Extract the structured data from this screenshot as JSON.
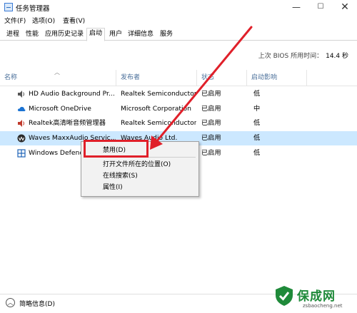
{
  "window": {
    "title": "任务管理器",
    "buttons": {
      "minimize": "—",
      "maximize": "☐",
      "close": "✕"
    }
  },
  "menu": [
    "文件(F)",
    "选项(O)",
    "查看(V)"
  ],
  "tabs": [
    {
      "label": "进程",
      "active": false
    },
    {
      "label": "性能",
      "active": false
    },
    {
      "label": "应用历史记录",
      "active": false
    },
    {
      "label": "启动",
      "active": true
    },
    {
      "label": "用户",
      "active": false
    },
    {
      "label": "详细信息",
      "active": false
    },
    {
      "label": "服务",
      "active": false
    }
  ],
  "bios": {
    "label": "上次 BIOS 所用时间：",
    "value": "14.4 秒"
  },
  "columns": {
    "name": "名称",
    "publisher": "发布者",
    "status": "状态",
    "impact": "启动影响"
  },
  "rows": [
    {
      "icon": "speaker-icon",
      "name": "HD Audio Background Pr...",
      "publisher": "Realtek Semiconductor",
      "status": "已启用",
      "impact": "低",
      "selected": false
    },
    {
      "icon": "onedrive-icon",
      "name": "Microsoft OneDrive",
      "publisher": "Microsoft Corporation",
      "status": "已启用",
      "impact": "中",
      "selected": false
    },
    {
      "icon": "speaker-icon",
      "name": "Realtek高清晰音频管理器",
      "publisher": "Realtek Semiconductor",
      "status": "已启用",
      "impact": "低",
      "selected": false
    },
    {
      "icon": "waves-icon",
      "name": "Waves MaxxAudio Servic...",
      "publisher": "Waves Audio Ltd.",
      "status": "已启用",
      "impact": "低",
      "selected": true
    },
    {
      "icon": "windows-defender-icon",
      "name": "Windows Defender",
      "publisher": "",
      "status": "已启用",
      "impact": "低",
      "selected": false
    }
  ],
  "context_menu": {
    "disable": "禁用(D)",
    "open_location": "打开文件所在的位置(O)",
    "search_online": "在线搜索(S)",
    "properties": "属性(I)"
  },
  "footer": {
    "label": "简略信息(D)"
  },
  "watermark": {
    "brand": "保成网",
    "url": "zsbaocheng.net"
  },
  "colors": {
    "selected_row": "#cce8ff",
    "annotation_red": "#e0202a",
    "header_text": "#4a6f9a",
    "brand_green": "#1f8a3a"
  }
}
